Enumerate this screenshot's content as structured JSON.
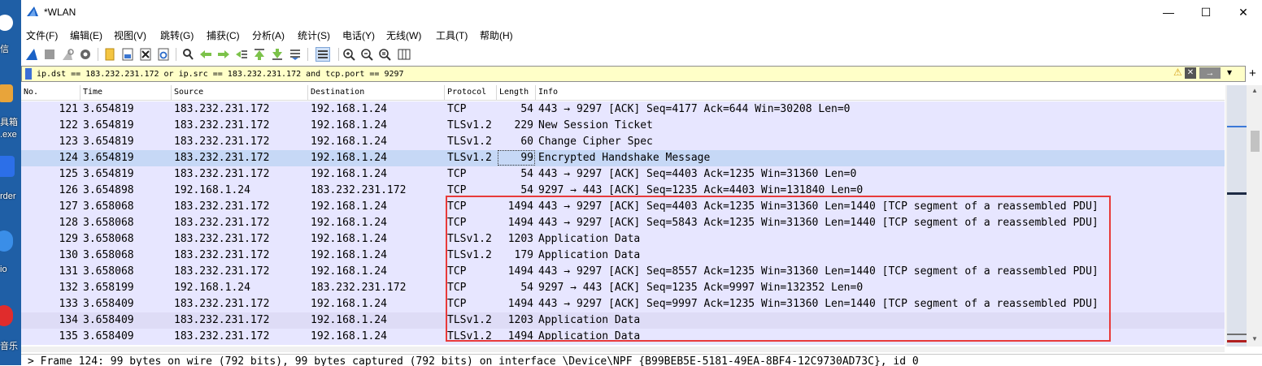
{
  "desktop": {
    "labels": [
      "信",
      "具箱",
      ".exe",
      "rder",
      "io",
      "音乐"
    ]
  },
  "window": {
    "title": "*WLAN",
    "minimize_symbol": "—",
    "maximize_symbol": "☐",
    "close_symbol": "✕"
  },
  "menu": [
    "文件(F)",
    "编辑(E)",
    "视图(V)",
    "跳转(G)",
    "捕获(C)",
    "分析(A)",
    "统计(S)",
    "电话(Y)",
    "无线(W)",
    "工具(T)",
    "帮助(H)"
  ],
  "filter": {
    "value": "ip.dst == 183.232.231.172 or ip.src == 183.232.231.172 and tcp.port == 9297",
    "warning_symbol": "⚠",
    "clear_symbol": "✕",
    "apply_symbol": "→",
    "dropdown_symbol": "▾",
    "plus_symbol": "+"
  },
  "columns": {
    "no": "No.",
    "time": "Time",
    "source": "Source",
    "destination": "Destination",
    "protocol": "Protocol",
    "length": "Length",
    "info": "Info"
  },
  "packets": [
    {
      "no": "121",
      "time": "3.654819",
      "src": "183.232.231.172",
      "dst": "192.168.1.24",
      "proto": "TCP",
      "len": "54",
      "info": "443 → 9297 [ACK] Seq=4177 Ack=644 Win=30208 Len=0"
    },
    {
      "no": "122",
      "time": "3.654819",
      "src": "183.232.231.172",
      "dst": "192.168.1.24",
      "proto": "TLSv1.2",
      "len": "229",
      "info": "New Session Ticket"
    },
    {
      "no": "123",
      "time": "3.654819",
      "src": "183.232.231.172",
      "dst": "192.168.1.24",
      "proto": "TLSv1.2",
      "len": "60",
      "info": "Change Cipher Spec"
    },
    {
      "no": "124",
      "time": "3.654819",
      "src": "183.232.231.172",
      "dst": "192.168.1.24",
      "proto": "TLSv1.2",
      "len": "99",
      "info": "Encrypted Handshake Message"
    },
    {
      "no": "125",
      "time": "3.654819",
      "src": "183.232.231.172",
      "dst": "192.168.1.24",
      "proto": "TCP",
      "len": "54",
      "info": "443 → 9297 [ACK] Seq=4403 Ack=1235 Win=31360 Len=0"
    },
    {
      "no": "126",
      "time": "3.654898",
      "src": "192.168.1.24",
      "dst": "183.232.231.172",
      "proto": "TCP",
      "len": "54",
      "info": "9297 → 443 [ACK] Seq=1235 Ack=4403 Win=131840 Len=0"
    },
    {
      "no": "127",
      "time": "3.658068",
      "src": "183.232.231.172",
      "dst": "192.168.1.24",
      "proto": "TCP",
      "len": "1494",
      "info": "443 → 9297 [ACK] Seq=4403 Ack=1235 Win=31360 Len=1440 [TCP segment of a reassembled PDU]"
    },
    {
      "no": "128",
      "time": "3.658068",
      "src": "183.232.231.172",
      "dst": "192.168.1.24",
      "proto": "TCP",
      "len": "1494",
      "info": "443 → 9297 [ACK] Seq=5843 Ack=1235 Win=31360 Len=1440 [TCP segment of a reassembled PDU]"
    },
    {
      "no": "129",
      "time": "3.658068",
      "src": "183.232.231.172",
      "dst": "192.168.1.24",
      "proto": "TLSv1.2",
      "len": "1203",
      "info": "Application Data"
    },
    {
      "no": "130",
      "time": "3.658068",
      "src": "183.232.231.172",
      "dst": "192.168.1.24",
      "proto": "TLSv1.2",
      "len": "179",
      "info": "Application Data"
    },
    {
      "no": "131",
      "time": "3.658068",
      "src": "183.232.231.172",
      "dst": "192.168.1.24",
      "proto": "TCP",
      "len": "1494",
      "info": "443 → 9297 [ACK] Seq=8557 Ack=1235 Win=31360 Len=1440 [TCP segment of a reassembled PDU]"
    },
    {
      "no": "132",
      "time": "3.658199",
      "src": "192.168.1.24",
      "dst": "183.232.231.172",
      "proto": "TCP",
      "len": "54",
      "info": "9297 → 443 [ACK] Seq=1235 Ack=9997 Win=132352 Len=0"
    },
    {
      "no": "133",
      "time": "3.658409",
      "src": "183.232.231.172",
      "dst": "192.168.1.24",
      "proto": "TCP",
      "len": "1494",
      "info": "443 → 9297 [ACK] Seq=9997 Ack=1235 Win=31360 Len=1440 [TCP segment of a reassembled PDU]"
    },
    {
      "no": "134",
      "time": "3.658409",
      "src": "183.232.231.172",
      "dst": "192.168.1.24",
      "proto": "TLSv1.2",
      "len": "1203",
      "info": "Application Data"
    },
    {
      "no": "135",
      "time": "3.658409",
      "src": "183.232.231.172",
      "dst": "192.168.1.24",
      "proto": "TLSv1.2",
      "len": "1494",
      "info": "Application Data"
    }
  ],
  "selected_packet": "124",
  "detail": {
    "text": "> Frame 124: 99 bytes on wire (792 bits), 99 bytes captured (792 bits) on interface \\Device\\NPF_{B99BEB5E-5181-49EA-8BF4-12C9730AD73C}, id 0"
  },
  "colors": {
    "row_bg": "#e7e6ff",
    "selected_bg": "#c6d8f6",
    "filter_bg": "#ffffc8",
    "highlight_box": "#e83a3a"
  },
  "toolbar_icons": [
    "shark-fin-start-icon",
    "stop-capture-icon",
    "restart-capture-icon",
    "capture-options-icon",
    "open-file-icon",
    "save-file-icon",
    "close-file-icon",
    "reload-file-icon",
    "find-packet-icon",
    "go-back-icon",
    "go-forward-icon",
    "go-to-packet-icon",
    "go-first-icon",
    "go-last-icon",
    "auto-scroll-icon",
    "colorize-icon",
    "zoom-in-icon",
    "zoom-out-icon",
    "zoom-normal-icon",
    "resize-columns-icon"
  ]
}
